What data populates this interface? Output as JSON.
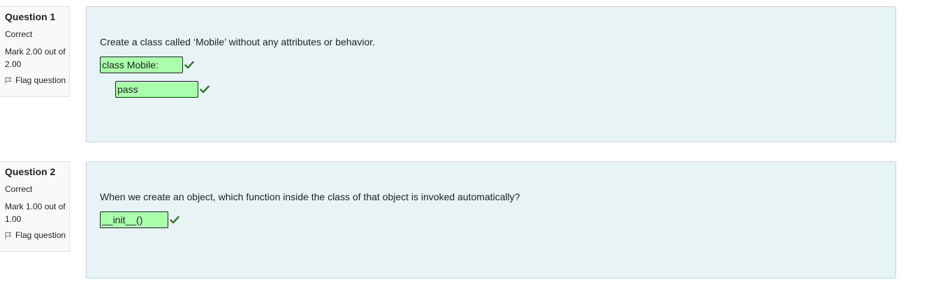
{
  "questions": [
    {
      "number_label": "Question 1",
      "state": "Correct",
      "mark": "Mark 2.00 out of 2.00",
      "flag_label": "Flag question",
      "text": "Create a class called ‘Mobile’ without any attributes or behavior.",
      "answers": [
        "class Mobile:",
        "pass"
      ]
    },
    {
      "number_label": "Question 2",
      "state": "Correct",
      "mark": "Mark 1.00 out of 1.00",
      "flag_label": "Flag question",
      "text": "When we create an object, which function inside the class of that object is invoked automatically?",
      "answers": [
        "__init__()"
      ]
    }
  ],
  "icons": {
    "correct": "check-icon",
    "flag": "flag-icon"
  },
  "colors": {
    "correct_answer_bg": "#aaffaa",
    "check_green": "#357a32",
    "content_bg": "#e7f3f5",
    "info_bg": "#f8f9fa"
  }
}
